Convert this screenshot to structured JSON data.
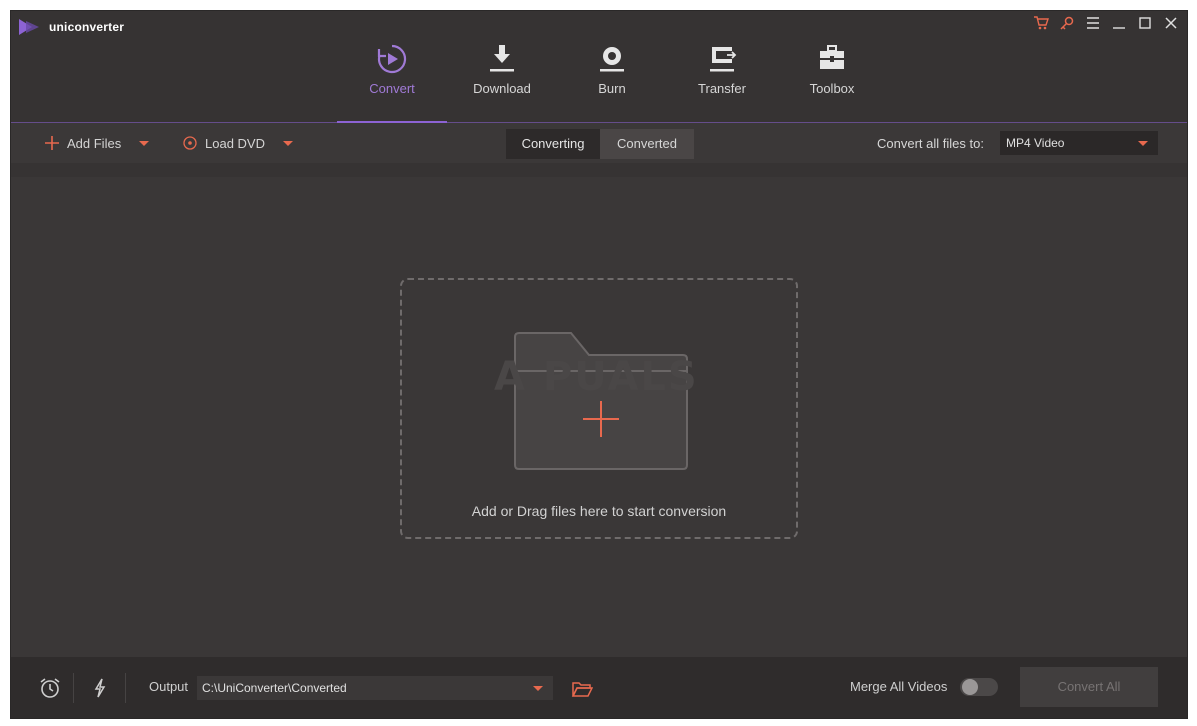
{
  "app": {
    "title": "uniconverter"
  },
  "window_controls": [
    "cart-icon",
    "key-icon",
    "menu-icon",
    "minimize-icon",
    "maximize-icon",
    "close-icon"
  ],
  "nav": {
    "items": [
      {
        "label": "Convert",
        "icon": "convert-icon",
        "active": true
      },
      {
        "label": "Download",
        "icon": "download-icon",
        "active": false
      },
      {
        "label": "Burn",
        "icon": "burn-icon",
        "active": false
      },
      {
        "label": "Transfer",
        "icon": "transfer-icon",
        "active": false
      },
      {
        "label": "Toolbox",
        "icon": "toolbox-icon",
        "active": false
      }
    ]
  },
  "toolbar": {
    "add_files": "Add Files",
    "load_dvd": "Load DVD",
    "tabs": [
      {
        "label": "Converting",
        "active": true
      },
      {
        "label": "Converted",
        "active": false
      }
    ],
    "convert_all_label": "Convert all files to:",
    "format_value": "MP4 Video"
  },
  "main": {
    "drop_text": "Add or Drag files here to start conversion",
    "watermark": "A  PUALS"
  },
  "bottom": {
    "output_label": "Output",
    "output_path": "C:\\UniConverter\\Converted",
    "merge_label": "Merge All Videos",
    "merge_enabled": false,
    "convert_all_button": "Convert All"
  },
  "colors": {
    "accent": "#8d63d4",
    "active_text": "#a07ad6",
    "orange": "#e8694e",
    "background": "#3a3737"
  }
}
